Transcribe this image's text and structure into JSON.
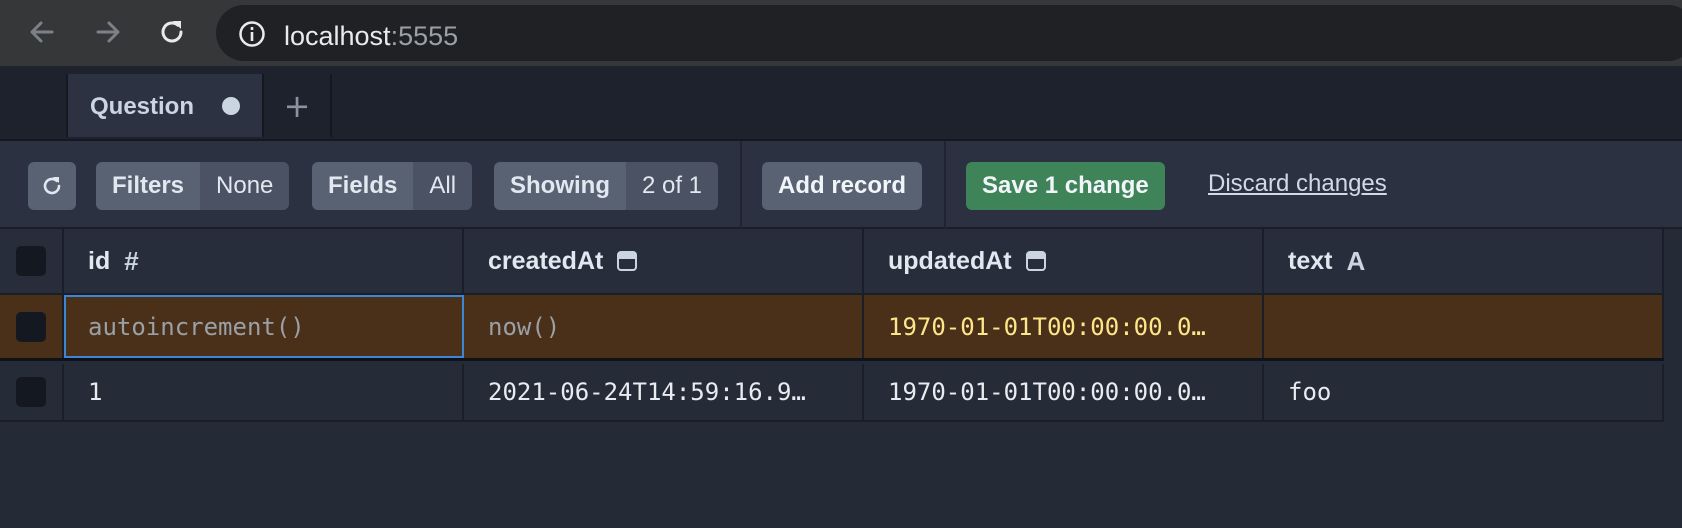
{
  "browser": {
    "url_host": "localhost",
    "url_port": ":5555"
  },
  "tabs": {
    "active_label": "Question",
    "add_label": "+"
  },
  "toolbar": {
    "filters_label": "Filters",
    "filters_value": "None",
    "fields_label": "Fields",
    "fields_value": "All",
    "showing_label": "Showing",
    "showing_value": "2 of 1",
    "add_record_label": "Add record",
    "save_label": "Save 1 change",
    "discard_label": "Discard changes"
  },
  "table": {
    "columns": [
      {
        "name": "id",
        "type_icon": "#"
      },
      {
        "name": "createdAt",
        "type_icon": "calendar-icon"
      },
      {
        "name": "updatedAt",
        "type_icon": "calendar-icon"
      },
      {
        "name": "text",
        "type_icon": "A"
      }
    ],
    "new_row": {
      "id": "autoincrement()",
      "createdAt": "now()",
      "updatedAt": "1970-01-01T00:00:00.0…",
      "text": ""
    },
    "rows": [
      {
        "id": "1",
        "createdAt": "2021-06-24T14:59:16.9…",
        "updatedAt": "1970-01-01T00:00:00.0…",
        "text": "foo"
      }
    ]
  },
  "colors": {
    "accent_save": "#3f8358",
    "new_row_bg": "#4a3019",
    "selection_border": "#3d86d6"
  }
}
